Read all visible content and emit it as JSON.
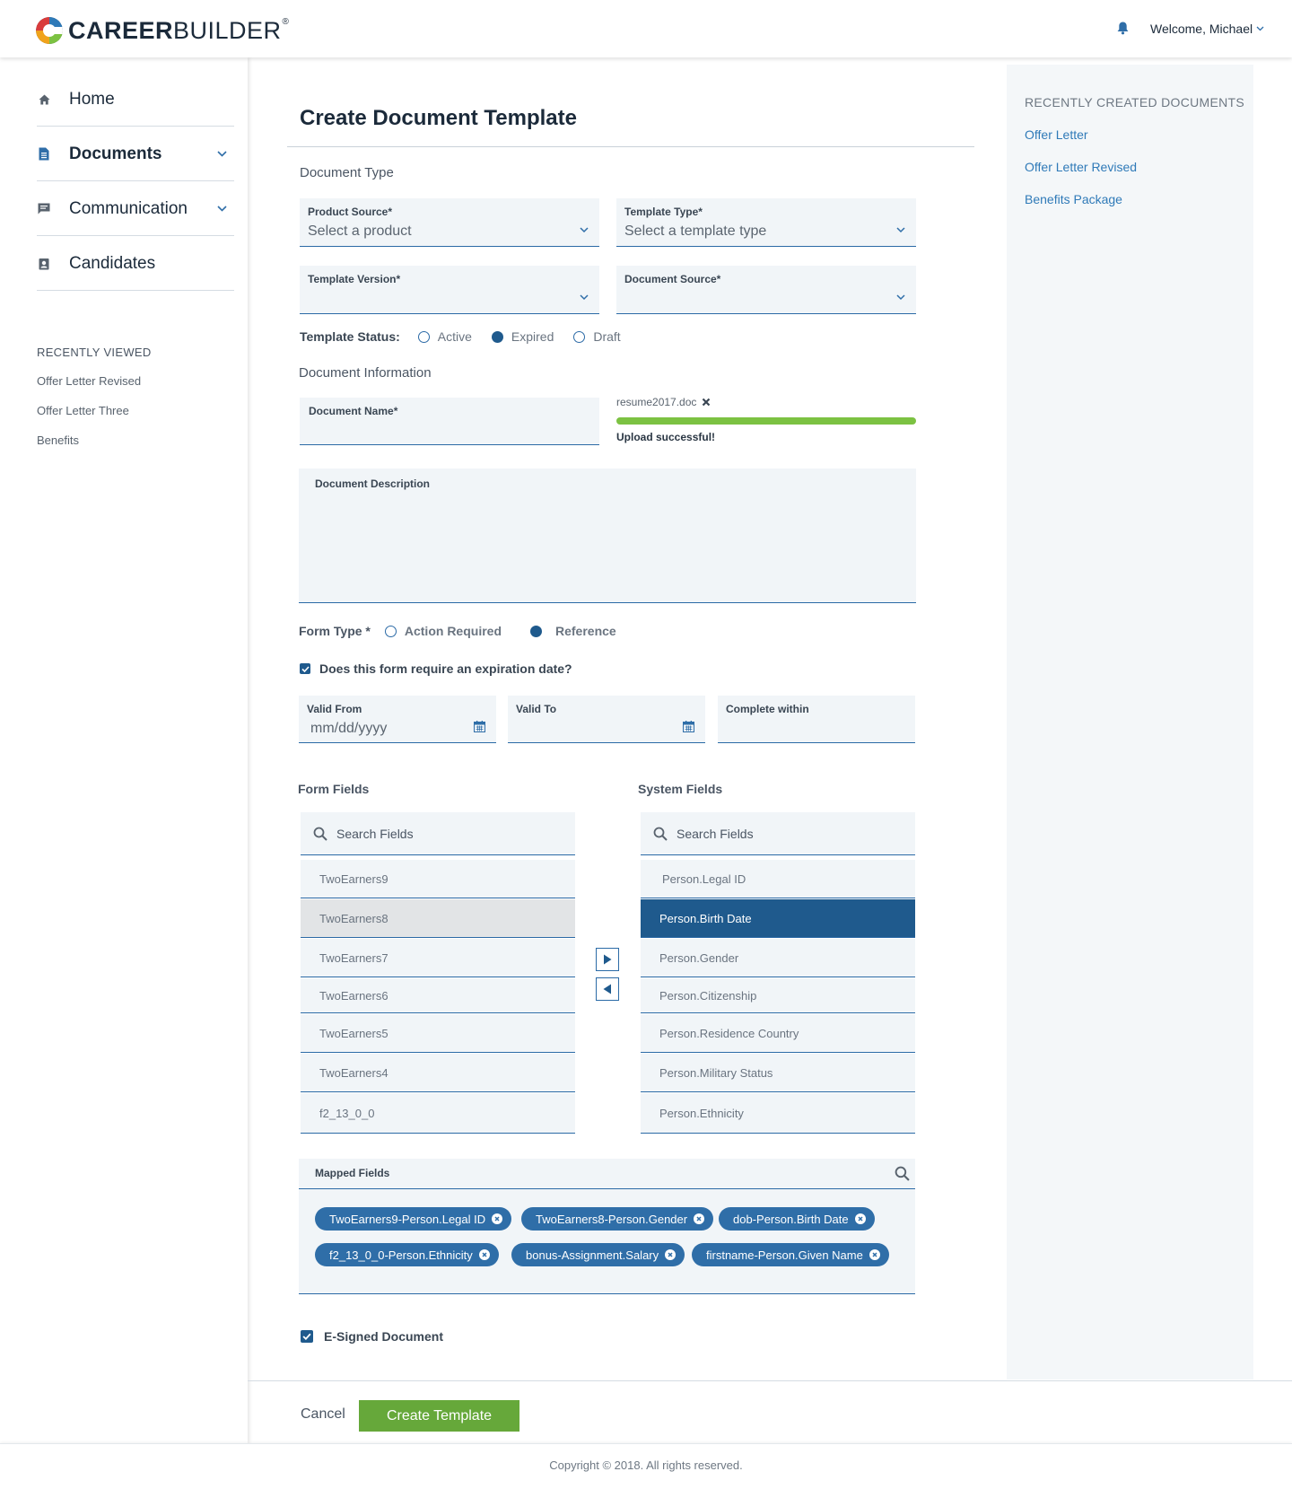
{
  "header": {
    "brand_bold": "CAREER",
    "brand_light": "BUILDER",
    "brand_reg": "®",
    "welcome": "Welcome, Michael"
  },
  "sidebar": {
    "nav": [
      {
        "label": "Home",
        "icon": "home-icon"
      },
      {
        "label": "Documents",
        "icon": "document-icon"
      },
      {
        "label": "Communication",
        "icon": "chat-icon"
      },
      {
        "label": "Candidates",
        "icon": "contact-card-icon"
      }
    ],
    "recently_viewed_title": "RECENTLY VIEWED",
    "recently_viewed": [
      "Offer Letter Revised",
      "Offer Letter Three",
      "Benefits"
    ]
  },
  "right_panel": {
    "title": "RECENTLY CREATED DOCUMENTS",
    "links": [
      "Offer Letter",
      "Offer Letter Revised",
      "Benefits Package"
    ]
  },
  "main": {
    "title": "Create Document Template",
    "document_type_label": "Document Type",
    "product_source": {
      "label": "Product Source*",
      "value": "Select a product"
    },
    "template_type": {
      "label": "Template Type*",
      "value": "Select a template type"
    },
    "template_version": {
      "label": "Template Version*",
      "value": ""
    },
    "document_source": {
      "label": "Document Source*",
      "value": ""
    },
    "template_status": {
      "label": "Template Status:",
      "options": [
        "Active",
        "Expired",
        "Draft"
      ],
      "selected": "Expired"
    },
    "document_information_label": "Document Information",
    "document_name": {
      "label": "Document Name*",
      "value": ""
    },
    "upload": {
      "filename": "resume2017.doc",
      "status": "Upload successful!",
      "progress": 1.0
    },
    "document_description": {
      "label": "Document Description",
      "value": ""
    },
    "form_type": {
      "label": "Form Type *",
      "options": [
        "Action Required",
        "Reference"
      ],
      "selected": "Reference"
    },
    "expiration_checkbox": {
      "label": "Does this form require an expiration date?",
      "checked": true
    },
    "valid_from": {
      "label": "Valid From",
      "placeholder": "mm/dd/yyyy"
    },
    "valid_to": {
      "label": "Valid To",
      "value": ""
    },
    "complete_within": {
      "label": "Complete within",
      "value": ""
    },
    "form_fields": {
      "title": "Form Fields",
      "search_placeholder": "Search Fields",
      "items": [
        "TwoEarners9",
        "TwoEarners8",
        "TwoEarners7",
        "TwoEarners6",
        "TwoEarners5",
        "TwoEarners4",
        "f2_13_0_0"
      ],
      "highlighted": "TwoEarners8"
    },
    "system_fields": {
      "title": "System Fields",
      "search_placeholder": "Search Fields",
      "items": [
        "Person.Legal ID",
        "Person.Birth Date",
        "Person.Gender",
        "Person.Citizenship",
        "Person.Residence Country",
        "Person.Military Status",
        "Person.Ethnicity"
      ],
      "selected": "Person.Birth Date"
    },
    "mapped_fields": {
      "label": "Mapped Fields",
      "chips": [
        "TwoEarners9-Person.Legal ID",
        "TwoEarners8-Person.Gender",
        "dob-Person.Birth Date",
        "f2_13_0_0-Person.Ethnicity",
        "bonus-Assignment.Salary",
        "firstname-Person.Given Name"
      ]
    },
    "esigned": {
      "label": "E-Signed Document",
      "checked": true
    },
    "cancel_label": "Cancel",
    "create_label": "Create Template"
  },
  "footer": {
    "copyright": "Copyright © 2018. All rights reserved."
  },
  "colors": {
    "primary": "#1f5a8d",
    "link": "#2f7ab8",
    "chip": "#2f6ea8",
    "success": "#7cc242",
    "create_button": "#66a83a",
    "field_bg": "#f1f5f8"
  }
}
